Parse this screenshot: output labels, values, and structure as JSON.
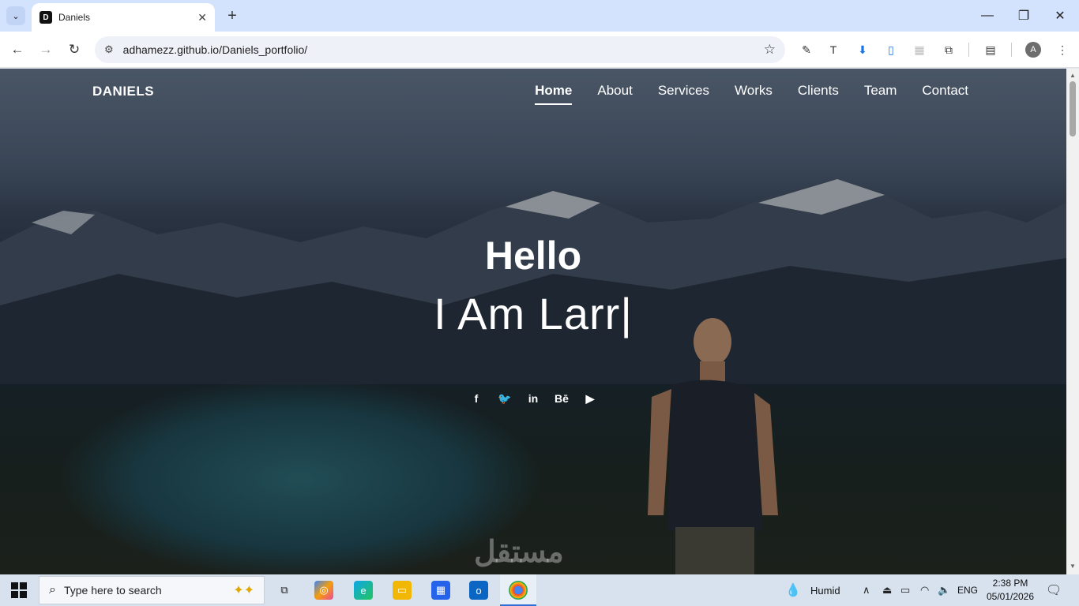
{
  "browser": {
    "tab_title": "Daniels",
    "tab_favicon": "D",
    "url": "adhamezz.github.io/Daniels_portfolio/",
    "profile_initial": "A"
  },
  "site": {
    "brand": "DANIELS",
    "menu": [
      {
        "label": "Home",
        "active": true
      },
      {
        "label": "About",
        "active": false
      },
      {
        "label": "Services",
        "active": false
      },
      {
        "label": "Works",
        "active": false
      },
      {
        "label": "Clients",
        "active": false
      },
      {
        "label": "Team",
        "active": false
      },
      {
        "label": "Contact",
        "active": false
      }
    ],
    "hero_hello": "Hello",
    "hero_prefix": "I Am",
    "hero_name": "Larr",
    "hero_cursor": "|",
    "socials": {
      "facebook": "f",
      "twitter": "🐦",
      "linkedin": "in",
      "behance": "Bē",
      "youtube": "▶"
    },
    "watermark": "مستقل"
  },
  "taskbar": {
    "search_placeholder": "Type here to search",
    "weather": "Humid",
    "language": "ENG",
    "time": "2:38 PM",
    "date": "05/01/2026"
  }
}
